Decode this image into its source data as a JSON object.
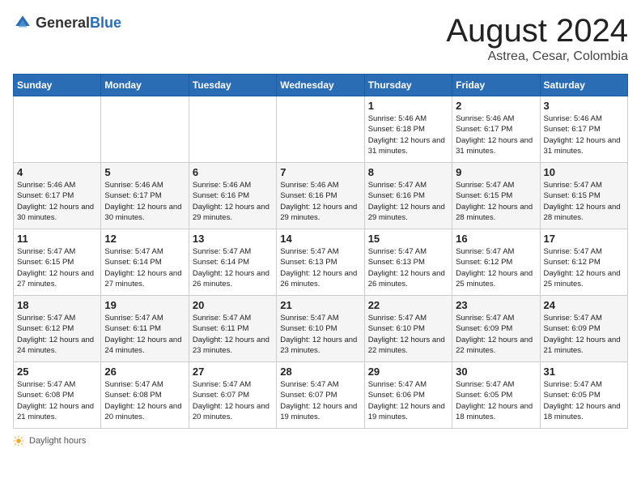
{
  "header": {
    "logo_general": "General",
    "logo_blue": "Blue",
    "title": "August 2024",
    "subtitle": "Astrea, Cesar, Colombia"
  },
  "weekdays": [
    "Sunday",
    "Monday",
    "Tuesday",
    "Wednesday",
    "Thursday",
    "Friday",
    "Saturday"
  ],
  "weeks": [
    [
      {
        "day": "",
        "info": ""
      },
      {
        "day": "",
        "info": ""
      },
      {
        "day": "",
        "info": ""
      },
      {
        "day": "",
        "info": ""
      },
      {
        "day": "1",
        "info": "Sunrise: 5:46 AM\nSunset: 6:18 PM\nDaylight: 12 hours\nand 31 minutes."
      },
      {
        "day": "2",
        "info": "Sunrise: 5:46 AM\nSunset: 6:17 PM\nDaylight: 12 hours\nand 31 minutes."
      },
      {
        "day": "3",
        "info": "Sunrise: 5:46 AM\nSunset: 6:17 PM\nDaylight: 12 hours\nand 31 minutes."
      }
    ],
    [
      {
        "day": "4",
        "info": "Sunrise: 5:46 AM\nSunset: 6:17 PM\nDaylight: 12 hours\nand 30 minutes."
      },
      {
        "day": "5",
        "info": "Sunrise: 5:46 AM\nSunset: 6:17 PM\nDaylight: 12 hours\nand 30 minutes."
      },
      {
        "day": "6",
        "info": "Sunrise: 5:46 AM\nSunset: 6:16 PM\nDaylight: 12 hours\nand 29 minutes."
      },
      {
        "day": "7",
        "info": "Sunrise: 5:46 AM\nSunset: 6:16 PM\nDaylight: 12 hours\nand 29 minutes."
      },
      {
        "day": "8",
        "info": "Sunrise: 5:47 AM\nSunset: 6:16 PM\nDaylight: 12 hours\nand 29 minutes."
      },
      {
        "day": "9",
        "info": "Sunrise: 5:47 AM\nSunset: 6:15 PM\nDaylight: 12 hours\nand 28 minutes."
      },
      {
        "day": "10",
        "info": "Sunrise: 5:47 AM\nSunset: 6:15 PM\nDaylight: 12 hours\nand 28 minutes."
      }
    ],
    [
      {
        "day": "11",
        "info": "Sunrise: 5:47 AM\nSunset: 6:15 PM\nDaylight: 12 hours\nand 27 minutes."
      },
      {
        "day": "12",
        "info": "Sunrise: 5:47 AM\nSunset: 6:14 PM\nDaylight: 12 hours\nand 27 minutes."
      },
      {
        "day": "13",
        "info": "Sunrise: 5:47 AM\nSunset: 6:14 PM\nDaylight: 12 hours\nand 26 minutes."
      },
      {
        "day": "14",
        "info": "Sunrise: 5:47 AM\nSunset: 6:13 PM\nDaylight: 12 hours\nand 26 minutes."
      },
      {
        "day": "15",
        "info": "Sunrise: 5:47 AM\nSunset: 6:13 PM\nDaylight: 12 hours\nand 26 minutes."
      },
      {
        "day": "16",
        "info": "Sunrise: 5:47 AM\nSunset: 6:12 PM\nDaylight: 12 hours\nand 25 minutes."
      },
      {
        "day": "17",
        "info": "Sunrise: 5:47 AM\nSunset: 6:12 PM\nDaylight: 12 hours\nand 25 minutes."
      }
    ],
    [
      {
        "day": "18",
        "info": "Sunrise: 5:47 AM\nSunset: 6:12 PM\nDaylight: 12 hours\nand 24 minutes."
      },
      {
        "day": "19",
        "info": "Sunrise: 5:47 AM\nSunset: 6:11 PM\nDaylight: 12 hours\nand 24 minutes."
      },
      {
        "day": "20",
        "info": "Sunrise: 5:47 AM\nSunset: 6:11 PM\nDaylight: 12 hours\nand 23 minutes."
      },
      {
        "day": "21",
        "info": "Sunrise: 5:47 AM\nSunset: 6:10 PM\nDaylight: 12 hours\nand 23 minutes."
      },
      {
        "day": "22",
        "info": "Sunrise: 5:47 AM\nSunset: 6:10 PM\nDaylight: 12 hours\nand 22 minutes."
      },
      {
        "day": "23",
        "info": "Sunrise: 5:47 AM\nSunset: 6:09 PM\nDaylight: 12 hours\nand 22 minutes."
      },
      {
        "day": "24",
        "info": "Sunrise: 5:47 AM\nSunset: 6:09 PM\nDaylight: 12 hours\nand 21 minutes."
      }
    ],
    [
      {
        "day": "25",
        "info": "Sunrise: 5:47 AM\nSunset: 6:08 PM\nDaylight: 12 hours\nand 21 minutes."
      },
      {
        "day": "26",
        "info": "Sunrise: 5:47 AM\nSunset: 6:08 PM\nDaylight: 12 hours\nand 20 minutes."
      },
      {
        "day": "27",
        "info": "Sunrise: 5:47 AM\nSunset: 6:07 PM\nDaylight: 12 hours\nand 20 minutes."
      },
      {
        "day": "28",
        "info": "Sunrise: 5:47 AM\nSunset: 6:07 PM\nDaylight: 12 hours\nand 19 minutes."
      },
      {
        "day": "29",
        "info": "Sunrise: 5:47 AM\nSunset: 6:06 PM\nDaylight: 12 hours\nand 19 minutes."
      },
      {
        "day": "30",
        "info": "Sunrise: 5:47 AM\nSunset: 6:05 PM\nDaylight: 12 hours\nand 18 minutes."
      },
      {
        "day": "31",
        "info": "Sunrise: 5:47 AM\nSunset: 6:05 PM\nDaylight: 12 hours\nand 18 minutes."
      }
    ]
  ],
  "footer": {
    "daylight_label": "Daylight hours"
  }
}
